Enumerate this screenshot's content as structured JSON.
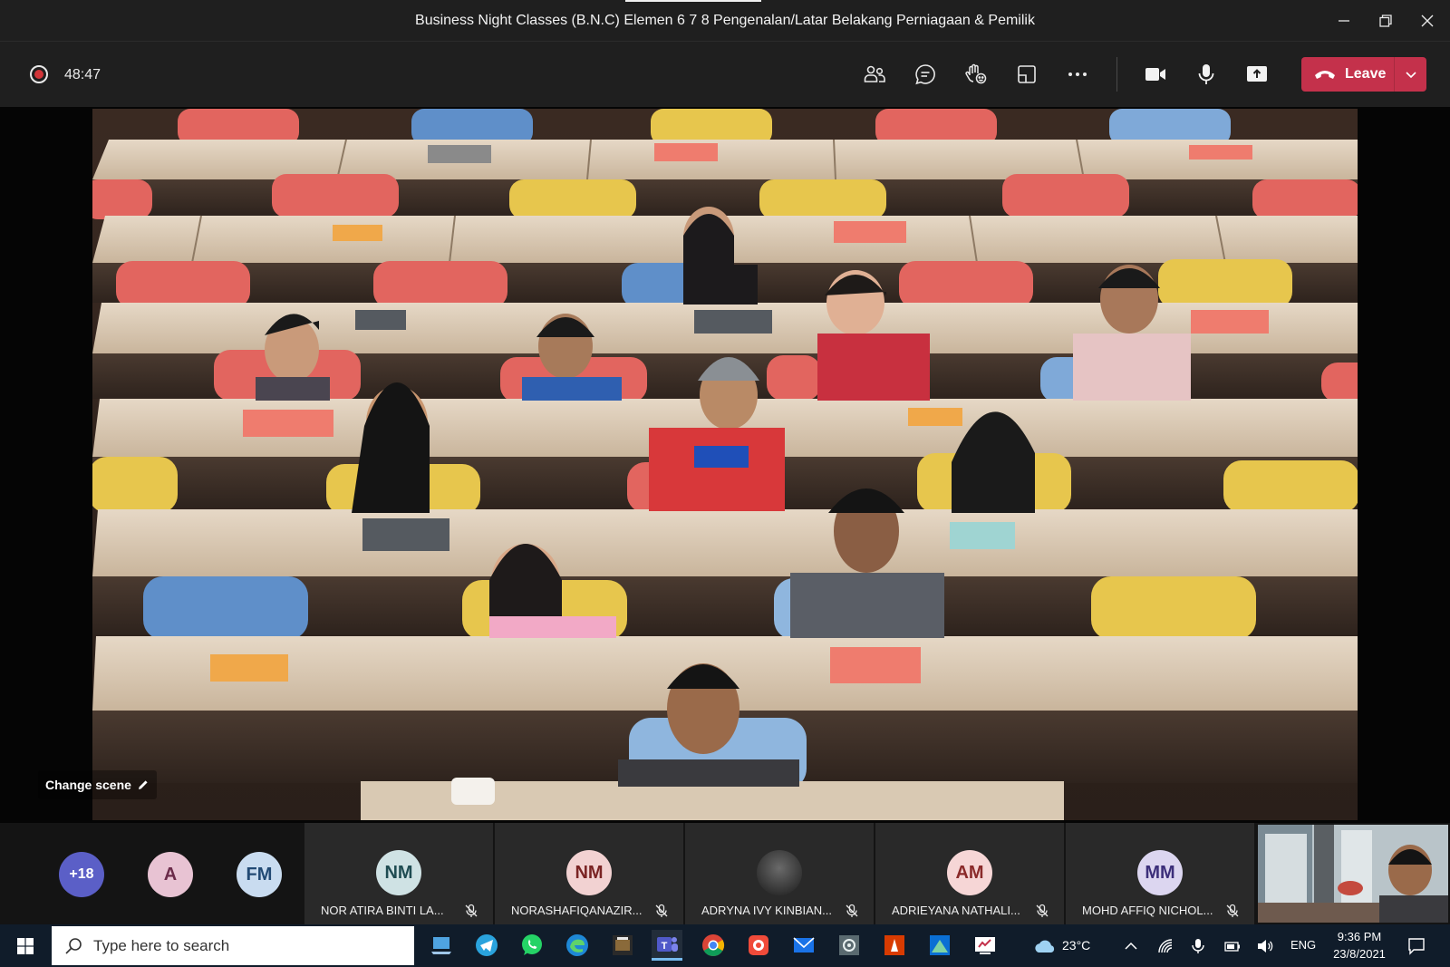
{
  "window": {
    "title": "Business Night Classes (B.N.C) Elemen 6 7 8 Pengenalan/Latar Belakang Perniagaan & Pemilik"
  },
  "toolbar": {
    "timer": "48:47",
    "leave_label": "Leave",
    "leave_color": "#c4314b",
    "record_color": "#d13438"
  },
  "stage": {
    "change_scene_label": "Change scene"
  },
  "participants": {
    "overflow_count": "+18",
    "small_avatars": [
      {
        "initials": "A",
        "bg": "#e8c3d3",
        "fg": "#6b2b4a"
      },
      {
        "initials": "FM",
        "bg": "#c9dcf0",
        "fg": "#224a74"
      }
    ],
    "tiles": [
      {
        "initials": "NM",
        "name": "NOR ATIRA BINTI LA...",
        "bg": "#cfe2e4",
        "fg": "#1f4c52"
      },
      {
        "initials": "NM",
        "name": "NORASHAFIQANAZIR...",
        "bg": "#f2d2d2",
        "fg": "#7a2424"
      },
      {
        "initials": "",
        "name": "ADRYNA IVY KINBIAN...",
        "bg": "#3a3a3a",
        "fg": "#ffffff"
      },
      {
        "initials": "AM",
        "name": "ADRIEYANA NATHALI...",
        "bg": "#f6d6d6",
        "fg": "#8a2a2a"
      },
      {
        "initials": "MM",
        "name": "MOHD AFFIQ NICHOL...",
        "bg": "#dcd6f0",
        "fg": "#3c2f7a"
      }
    ]
  },
  "taskbar": {
    "search_placeholder": "Type here to search",
    "weather": "23°C",
    "language": "ENG",
    "time": "9:36 PM",
    "date": "23/8/2021"
  }
}
